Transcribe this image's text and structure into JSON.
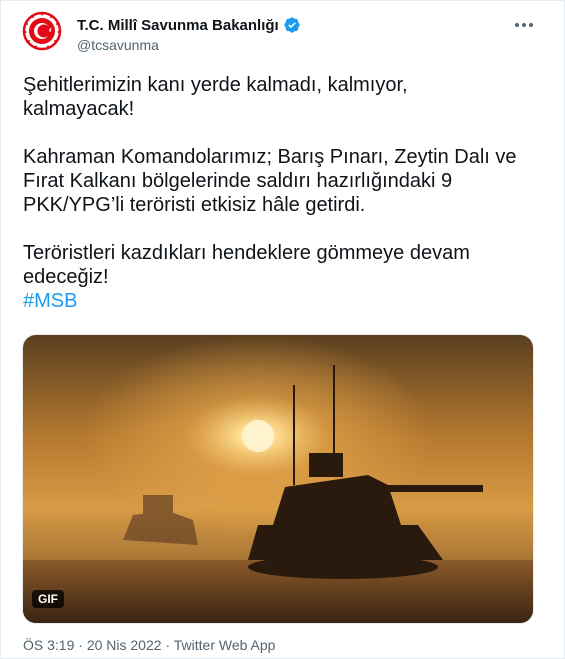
{
  "author": {
    "display_name": "T.C. Millî Savunma Bakanlığı",
    "handle": "@tcsavunma",
    "verified": true,
    "avatar_icon": "ministry-emblem-icon"
  },
  "tweet": {
    "paragraph1_line1": "Şehitlerimizin kanı yerde kalmadı, kalmıyor,",
    "paragraph1_line2": "kalmayacak!",
    "paragraph2_line1": "Kahraman Komandolarımız; Barış Pınarı, Zeytin Dalı ve",
    "paragraph2_line2": "Fırat Kalkanı bölgelerinde saldırı hazırlığındaki 9",
    "paragraph2_line3": "PKK/YPG’li teröristi etkisiz hâle getirdi.",
    "paragraph3_line1": "Teröristleri kazdıkları hendeklere gömmeye devam",
    "paragraph3_line2": "edeceğiz!",
    "hashtag": "#MSB"
  },
  "media": {
    "badge": "GIF"
  },
  "meta": {
    "time": "ÖS 3:19",
    "separator": "·",
    "date": "20 Nis 2022",
    "source": "Twitter Web App"
  },
  "colors": {
    "accent": "#1d9bf0",
    "brand_red": "#e30a17"
  }
}
